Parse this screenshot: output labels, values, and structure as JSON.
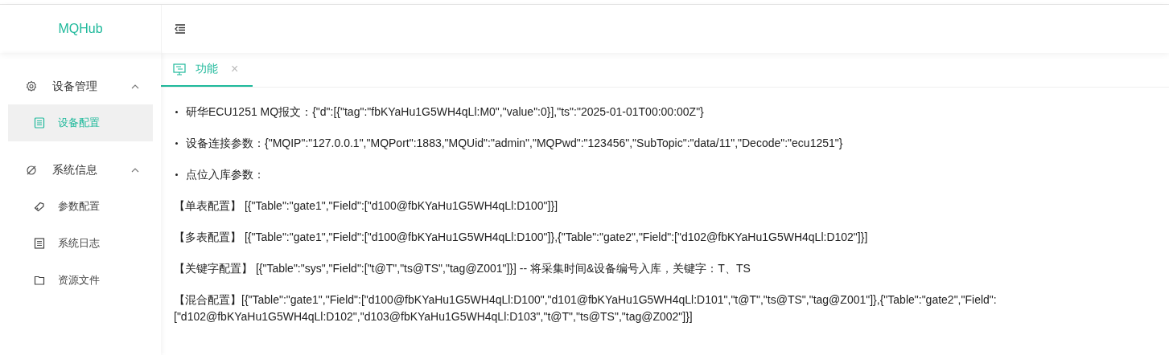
{
  "logo": "MQHub",
  "sidebar": {
    "groups": [
      {
        "label": "设备管理",
        "expanded": true,
        "items": [
          {
            "label": "设备配置",
            "selected": true
          }
        ]
      },
      {
        "label": "系统信息",
        "expanded": true,
        "items": [
          {
            "label": "参数配置",
            "selected": false
          },
          {
            "label": "系统日志",
            "selected": false
          },
          {
            "label": "资源文件",
            "selected": false
          }
        ]
      }
    ]
  },
  "tabs": [
    {
      "label": "功能",
      "selected": true,
      "close": "×"
    }
  ],
  "lines": [
    {
      "kind": "bullet",
      "text": "研华ECU1251 MQ报文：{\"d\":[{\"tag\":\"fbKYaHu1G5WH4qLl:M0\",\"value\":0}],\"ts\":\"2025-01-01T00:00:00Z\"}"
    },
    {
      "kind": "bullet",
      "text": "设备连接参数：{\"MQIP\":\"127.0.0.1\",\"MQPort\":1883,\"MQUid\":\"admin\",\"MQPwd\":\"123456\",\"SubTopic\":\"data/11\",\"Decode\":\"ecu1251\"}"
    },
    {
      "kind": "bullet",
      "text": "点位入库参数："
    },
    {
      "kind": "plain",
      "text": "【单表配置】 [{\"Table\":\"gate1\",\"Field\":[\"d100@fbKYaHu1G5WH4qLl:D100\"]}]"
    },
    {
      "kind": "plain",
      "text": "【多表配置】 [{\"Table\":\"gate1\",\"Field\":[\"d100@fbKYaHu1G5WH4qLl:D100\"]},{\"Table\":\"gate2\",\"Field\":[\"d102@fbKYaHu1G5WH4qLl:D102\"]}]"
    },
    {
      "kind": "plain",
      "text": "【关键字配置】 [{\"Table\":\"sys\",\"Field\":[\"t@T\",\"ts@TS\",\"tag@Z001\"]}] -- 将采集时间&设备编号入库，关键字：T、TS"
    },
    {
      "kind": "plain",
      "text": "【混合配置】[{\"Table\":\"gate1\",\"Field\":[\"d100@fbKYaHu1G5WH4qLl:D100\",\"d101@fbKYaHu1G5WH4qLl:D101\",\"t@T\",\"ts@TS\",\"tag@Z001\"]},{\"Table\":\"gate2\",\"Field\": [\"d102@fbKYaHu1G5WH4qLl:D102\",\"d103@fbKYaHu1G5WH4qLl:D103\",\"t@T\",\"ts@TS\",\"tag@Z002\"]}]"
    }
  ]
}
